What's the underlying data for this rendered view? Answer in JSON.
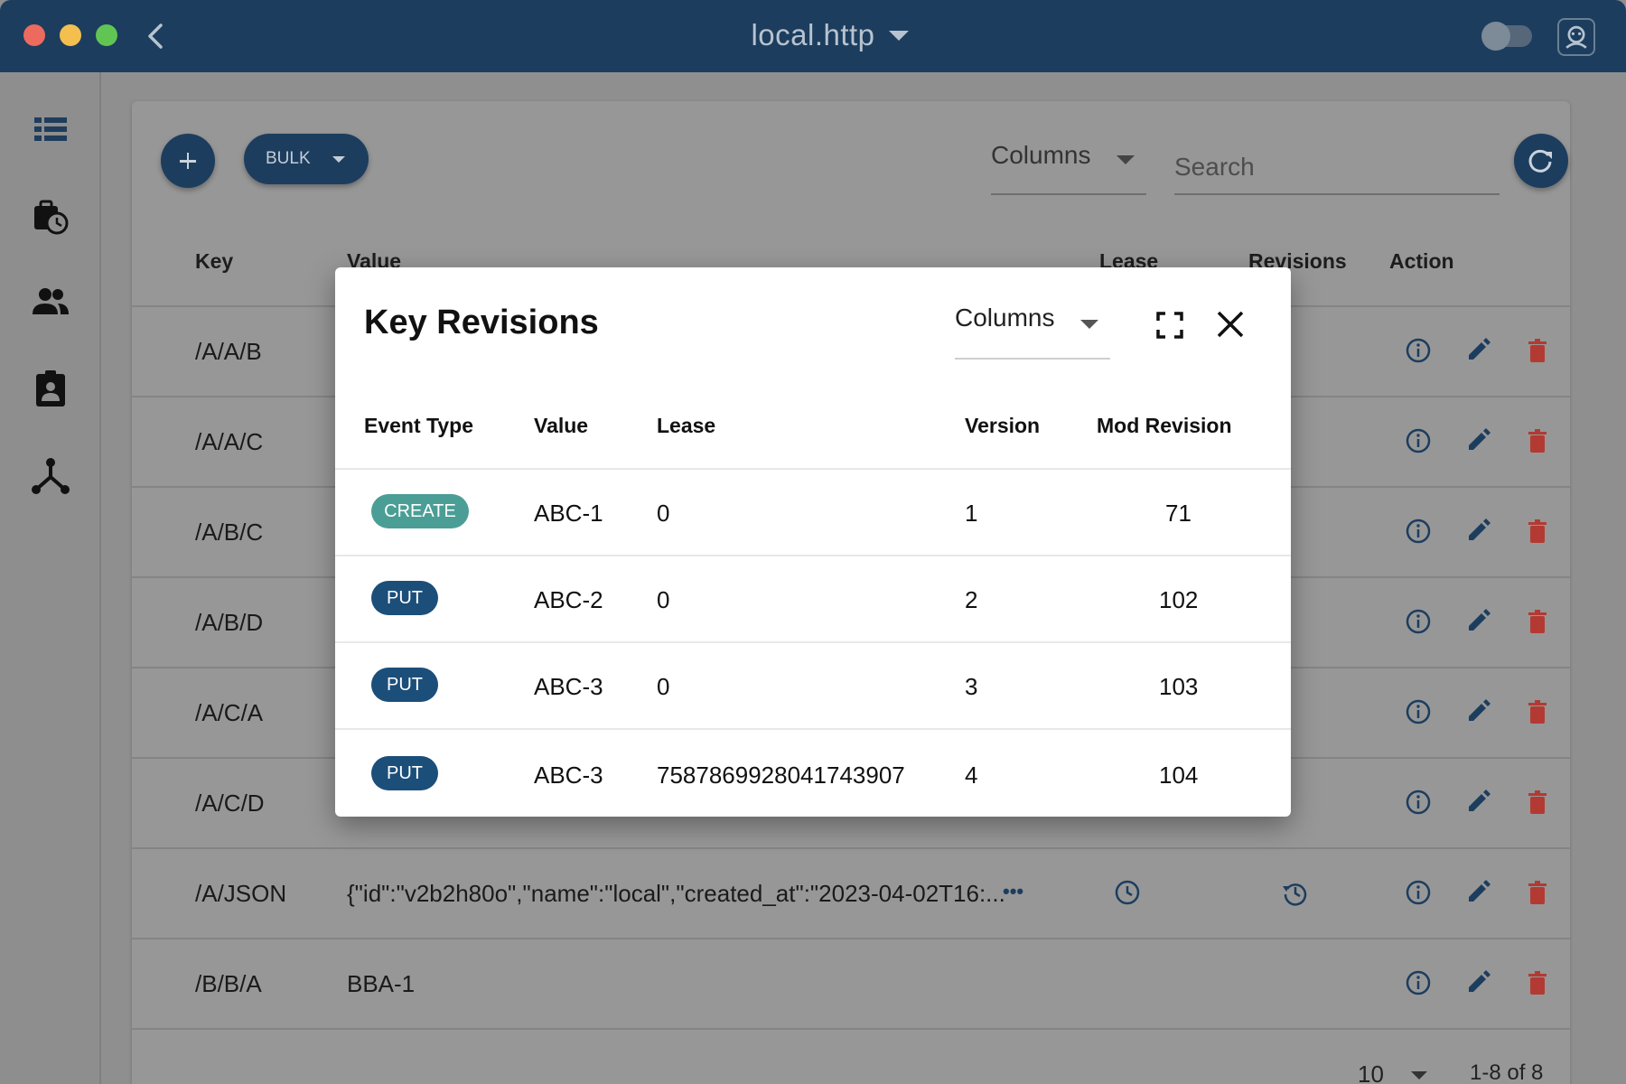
{
  "window": {
    "title": "local.http"
  },
  "toolbar": {
    "bulk_label": "BULK",
    "columns_label": "Columns",
    "search_placeholder": "Search"
  },
  "table": {
    "headers": {
      "key": "Key",
      "value": "Value",
      "lease": "Lease",
      "revisions": "Revisions",
      "action": "Action"
    },
    "rows": [
      {
        "key": "/A/A/B",
        "value": ""
      },
      {
        "key": "/A/A/C",
        "value": ""
      },
      {
        "key": "/A/B/C",
        "value": ""
      },
      {
        "key": "/A/B/D",
        "value": ""
      },
      {
        "key": "/A/C/A",
        "value": ""
      },
      {
        "key": "/A/C/D",
        "value": ""
      },
      {
        "key": "/A/JSON",
        "value": "{\"id\":\"v2b2h80o\",\"name\":\"local\",\"created_at\":\"2023-04-02T16:..."
      },
      {
        "key": "/B/B/A",
        "value": "BBA-1"
      }
    ],
    "more_label": "•••"
  },
  "pagination": {
    "per_page": "10",
    "range": "1-8 of 8"
  },
  "modal": {
    "title": "Key Revisions",
    "columns_label": "Columns",
    "headers": {
      "event_type": "Event Type",
      "value": "Value",
      "lease": "Lease",
      "version": "Version",
      "mod_revision": "Mod Revision"
    },
    "rows": [
      {
        "event_type": "CREATE",
        "value": "ABC-1",
        "lease": "0",
        "version": "1",
        "mod_revision": "71"
      },
      {
        "event_type": "PUT",
        "value": "ABC-2",
        "lease": "0",
        "version": "2",
        "mod_revision": "102"
      },
      {
        "event_type": "PUT",
        "value": "ABC-3",
        "lease": "0",
        "version": "3",
        "mod_revision": "103"
      },
      {
        "event_type": "PUT",
        "value": "ABC-3",
        "lease": "7587869928041743907",
        "version": "4",
        "mod_revision": "104"
      }
    ]
  },
  "colors": {
    "primary": "#1c3d5e",
    "create_chip": "#4a9e96",
    "put_chip": "#1c4e7a",
    "delete": "#b33a33"
  }
}
